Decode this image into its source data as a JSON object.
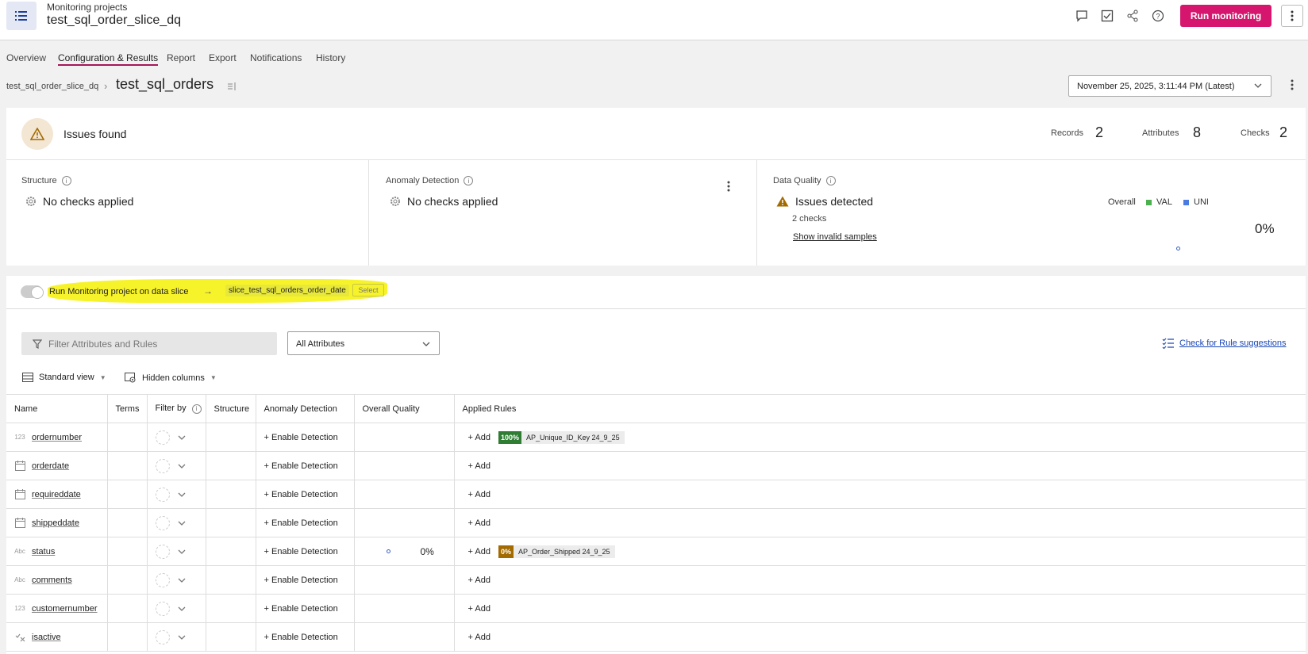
{
  "header": {
    "breadcrumb": "Monitoring projects",
    "title": "test_sql_order_slice_dq",
    "run_button": "Run monitoring",
    "icons": [
      "comment-icon",
      "task-check-icon",
      "share-icon",
      "help-icon",
      "more-vertical-icon"
    ]
  },
  "tabs": [
    "Overview",
    "Configuration & Results",
    "Report",
    "Export",
    "Notifications",
    "History"
  ],
  "active_tab": "Configuration & Results",
  "subheader": {
    "parent": "test_sql_order_slice_dq",
    "current": "test_sql_orders",
    "run_selector": "November 25, 2025, 3:11:44 PM (Latest)"
  },
  "summary": {
    "status_title": "Issues found",
    "stats": [
      {
        "label": "Records",
        "value": "2"
      },
      {
        "label": "Attributes",
        "value": "8"
      },
      {
        "label": "Checks",
        "value": "2"
      }
    ],
    "structure": {
      "title": "Structure",
      "status": "No checks applied"
    },
    "anomaly": {
      "title": "Anomaly Detection",
      "status": "No checks applied"
    },
    "data_quality": {
      "title": "Data Quality",
      "status": "Issues detected",
      "checks": "2 checks",
      "link": "Show invalid samples",
      "legend": [
        {
          "label": "Overall",
          "color": ""
        },
        {
          "label": "VAL",
          "color": "#4caf50"
        },
        {
          "label": "UNI",
          "color": "#4a7be0"
        }
      ],
      "overall_pct": "0%"
    }
  },
  "slice": {
    "label": "Run Monitoring project on data slice",
    "arrow": "→",
    "slice_name": "slice_test_sql_orders_order_date",
    "select": "Select",
    "enabled": false
  },
  "toolbar": {
    "filter_placeholder": "Filter Attributes and Rules",
    "attributes_select": "All Attributes",
    "rule_suggestions": "Check for Rule suggestions",
    "standard_view": "Standard view",
    "hidden_columns": "Hidden columns"
  },
  "table": {
    "headers": [
      "Name",
      "Terms",
      "Filter by",
      "Structure",
      "Anomaly Detection",
      "Overall Quality",
      "Applied Rules"
    ],
    "enable_label": "+ Enable Detection",
    "add_label": "+ Add",
    "rows": [
      {
        "type": "123",
        "name": "ordernumber",
        "quality": "",
        "rule_pct": "100%",
        "rule_name": "AP_Unique_ID_Key 24_9_25",
        "rule_color": "#2e7d32"
      },
      {
        "type": "date",
        "name": "orderdate",
        "quality": "",
        "rule_pct": "",
        "rule_name": "",
        "rule_color": ""
      },
      {
        "type": "date",
        "name": "requireddate",
        "quality": "",
        "rule_pct": "",
        "rule_name": "",
        "rule_color": ""
      },
      {
        "type": "date",
        "name": "shippeddate",
        "quality": "",
        "rule_pct": "",
        "rule_name": "",
        "rule_color": ""
      },
      {
        "type": "Abc",
        "name": "status",
        "quality": "0%",
        "rule_pct": "0%",
        "rule_name": "AP_Order_Shipped 24_9_25",
        "rule_color": "#a36a00"
      },
      {
        "type": "Abc",
        "name": "comments",
        "quality": "",
        "rule_pct": "",
        "rule_name": "",
        "rule_color": ""
      },
      {
        "type": "123",
        "name": "customernumber",
        "quality": "",
        "rule_pct": "",
        "rule_name": "",
        "rule_color": ""
      },
      {
        "type": "bool",
        "name": "isactive",
        "quality": "",
        "rule_pct": "",
        "rule_name": "",
        "rule_color": ""
      }
    ]
  }
}
